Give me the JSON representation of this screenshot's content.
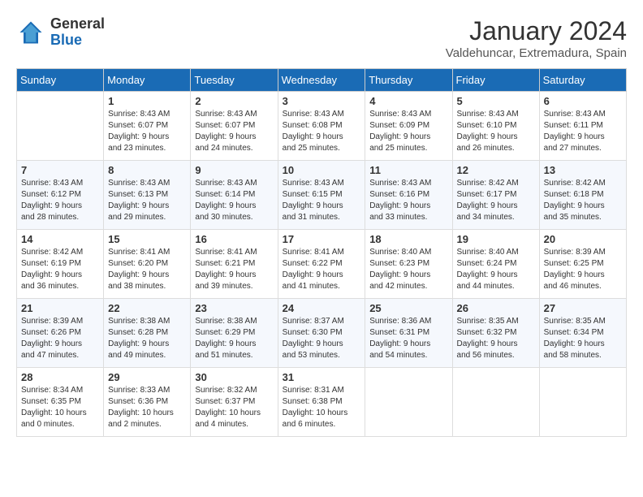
{
  "header": {
    "logo_general": "General",
    "logo_blue": "Blue",
    "month_title": "January 2024",
    "location": "Valdehuncar, Extremadura, Spain"
  },
  "columns": [
    "Sunday",
    "Monday",
    "Tuesday",
    "Wednesday",
    "Thursday",
    "Friday",
    "Saturday"
  ],
  "weeks": [
    [
      {
        "day": "",
        "info": ""
      },
      {
        "day": "1",
        "info": "Sunrise: 8:43 AM\nSunset: 6:07 PM\nDaylight: 9 hours\nand 23 minutes."
      },
      {
        "day": "2",
        "info": "Sunrise: 8:43 AM\nSunset: 6:07 PM\nDaylight: 9 hours\nand 24 minutes."
      },
      {
        "day": "3",
        "info": "Sunrise: 8:43 AM\nSunset: 6:08 PM\nDaylight: 9 hours\nand 25 minutes."
      },
      {
        "day": "4",
        "info": "Sunrise: 8:43 AM\nSunset: 6:09 PM\nDaylight: 9 hours\nand 25 minutes."
      },
      {
        "day": "5",
        "info": "Sunrise: 8:43 AM\nSunset: 6:10 PM\nDaylight: 9 hours\nand 26 minutes."
      },
      {
        "day": "6",
        "info": "Sunrise: 8:43 AM\nSunset: 6:11 PM\nDaylight: 9 hours\nand 27 minutes."
      }
    ],
    [
      {
        "day": "7",
        "info": "Sunrise: 8:43 AM\nSunset: 6:12 PM\nDaylight: 9 hours\nand 28 minutes."
      },
      {
        "day": "8",
        "info": "Sunrise: 8:43 AM\nSunset: 6:13 PM\nDaylight: 9 hours\nand 29 minutes."
      },
      {
        "day": "9",
        "info": "Sunrise: 8:43 AM\nSunset: 6:14 PM\nDaylight: 9 hours\nand 30 minutes."
      },
      {
        "day": "10",
        "info": "Sunrise: 8:43 AM\nSunset: 6:15 PM\nDaylight: 9 hours\nand 31 minutes."
      },
      {
        "day": "11",
        "info": "Sunrise: 8:43 AM\nSunset: 6:16 PM\nDaylight: 9 hours\nand 33 minutes."
      },
      {
        "day": "12",
        "info": "Sunrise: 8:42 AM\nSunset: 6:17 PM\nDaylight: 9 hours\nand 34 minutes."
      },
      {
        "day": "13",
        "info": "Sunrise: 8:42 AM\nSunset: 6:18 PM\nDaylight: 9 hours\nand 35 minutes."
      }
    ],
    [
      {
        "day": "14",
        "info": "Sunrise: 8:42 AM\nSunset: 6:19 PM\nDaylight: 9 hours\nand 36 minutes."
      },
      {
        "day": "15",
        "info": "Sunrise: 8:41 AM\nSunset: 6:20 PM\nDaylight: 9 hours\nand 38 minutes."
      },
      {
        "day": "16",
        "info": "Sunrise: 8:41 AM\nSunset: 6:21 PM\nDaylight: 9 hours\nand 39 minutes."
      },
      {
        "day": "17",
        "info": "Sunrise: 8:41 AM\nSunset: 6:22 PM\nDaylight: 9 hours\nand 41 minutes."
      },
      {
        "day": "18",
        "info": "Sunrise: 8:40 AM\nSunset: 6:23 PM\nDaylight: 9 hours\nand 42 minutes."
      },
      {
        "day": "19",
        "info": "Sunrise: 8:40 AM\nSunset: 6:24 PM\nDaylight: 9 hours\nand 44 minutes."
      },
      {
        "day": "20",
        "info": "Sunrise: 8:39 AM\nSunset: 6:25 PM\nDaylight: 9 hours\nand 46 minutes."
      }
    ],
    [
      {
        "day": "21",
        "info": "Sunrise: 8:39 AM\nSunset: 6:26 PM\nDaylight: 9 hours\nand 47 minutes."
      },
      {
        "day": "22",
        "info": "Sunrise: 8:38 AM\nSunset: 6:28 PM\nDaylight: 9 hours\nand 49 minutes."
      },
      {
        "day": "23",
        "info": "Sunrise: 8:38 AM\nSunset: 6:29 PM\nDaylight: 9 hours\nand 51 minutes."
      },
      {
        "day": "24",
        "info": "Sunrise: 8:37 AM\nSunset: 6:30 PM\nDaylight: 9 hours\nand 53 minutes."
      },
      {
        "day": "25",
        "info": "Sunrise: 8:36 AM\nSunset: 6:31 PM\nDaylight: 9 hours\nand 54 minutes."
      },
      {
        "day": "26",
        "info": "Sunrise: 8:35 AM\nSunset: 6:32 PM\nDaylight: 9 hours\nand 56 minutes."
      },
      {
        "day": "27",
        "info": "Sunrise: 8:35 AM\nSunset: 6:34 PM\nDaylight: 9 hours\nand 58 minutes."
      }
    ],
    [
      {
        "day": "28",
        "info": "Sunrise: 8:34 AM\nSunset: 6:35 PM\nDaylight: 10 hours\nand 0 minutes."
      },
      {
        "day": "29",
        "info": "Sunrise: 8:33 AM\nSunset: 6:36 PM\nDaylight: 10 hours\nand 2 minutes."
      },
      {
        "day": "30",
        "info": "Sunrise: 8:32 AM\nSunset: 6:37 PM\nDaylight: 10 hours\nand 4 minutes."
      },
      {
        "day": "31",
        "info": "Sunrise: 8:31 AM\nSunset: 6:38 PM\nDaylight: 10 hours\nand 6 minutes."
      },
      {
        "day": "",
        "info": ""
      },
      {
        "day": "",
        "info": ""
      },
      {
        "day": "",
        "info": ""
      }
    ]
  ]
}
